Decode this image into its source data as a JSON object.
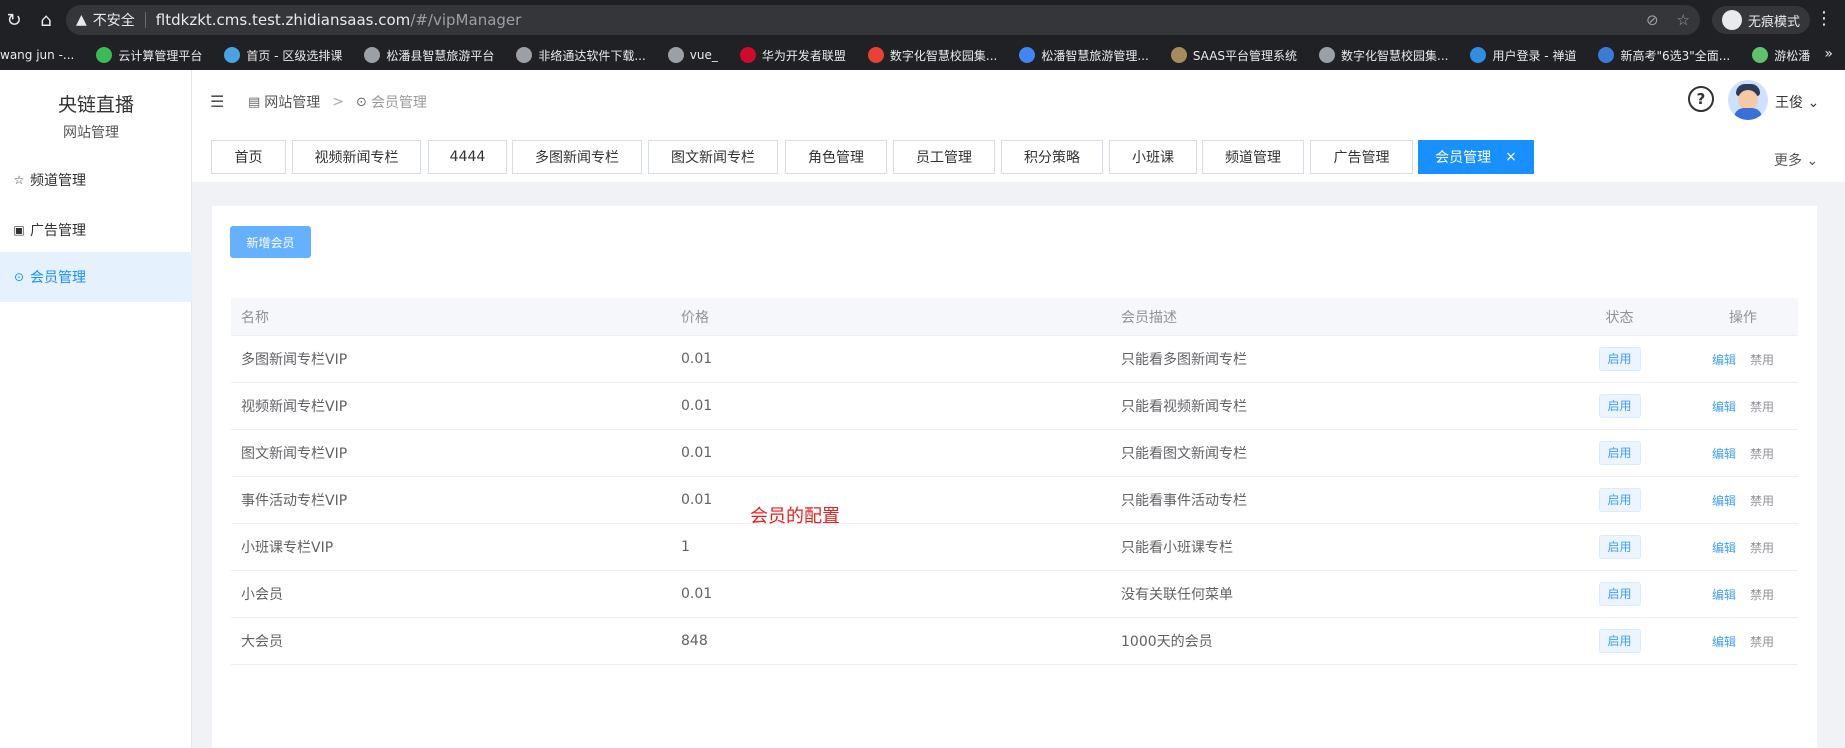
{
  "browser": {
    "insecure_label": "不安全",
    "url_host": "fltdkzkt.cms.test.zhidiansaas.com",
    "url_path": "/#/vipManager",
    "incognito_label": "无痕模式",
    "bookmarks": [
      {
        "label": "wang jun -...",
        "color": "#202124"
      },
      {
        "label": "云计算管理平台",
        "color": "#3cba54"
      },
      {
        "label": "首页 - 区级选排课",
        "color": "#4aa3df"
      },
      {
        "label": "松潘县智慧旅游平台",
        "color": "#9aa0a6"
      },
      {
        "label": "非络通达软件下载...",
        "color": "#9aa0a6"
      },
      {
        "label": "vue_",
        "color": "#9aa0a6"
      },
      {
        "label": "华为开发者联盟",
        "color": "#cf0a2c"
      },
      {
        "label": "数字化智慧校园集...",
        "color": "#e94235"
      },
      {
        "label": "松潘智慧旅游管理...",
        "color": "#4285f4"
      },
      {
        "label": "SAAS平台管理系统",
        "color": "#a68b5b"
      },
      {
        "label": "数字化智慧校园集...",
        "color": "#9aa0a6"
      },
      {
        "label": "用户登录 - 禅道",
        "color": "#2f8ee0"
      },
      {
        "label": "新高考\"6选3\"全面...",
        "color": "#3a7bd5"
      },
      {
        "label": "游松潘",
        "color": "#5ec26a"
      }
    ]
  },
  "sidebar": {
    "brand": "央链直播",
    "subtitle": "网站管理",
    "items": [
      {
        "label": "频道管理",
        "icon": "star-icon"
      },
      {
        "label": "广告管理",
        "icon": "picture-icon"
      },
      {
        "label": "会员管理",
        "icon": "play-circle-icon"
      }
    ]
  },
  "header": {
    "breadcrumb_root": "网站管理",
    "breadcrumb_current": "会员管理",
    "help_glyph": "?",
    "user_name": "王俊",
    "user_caret": "⌄"
  },
  "tabs": {
    "items": [
      "首页",
      "视频新闻专栏",
      "4444",
      "多图新闻专栏",
      "图文新闻专栏",
      "角色管理",
      "员工管理",
      "积分策略",
      "小班课",
      "频道管理",
      "广告管理",
      "会员管理"
    ],
    "close_glyph": "×",
    "more_label": "更多 ⌄"
  },
  "toolbar": {
    "add_button": "新增会员"
  },
  "table": {
    "columns": [
      "名称",
      "价格",
      "会员描述",
      "状态",
      "操作"
    ],
    "rows": [
      {
        "name": "多图新闻专栏VIP",
        "price": "0.01",
        "desc": "只能看多图新闻专栏",
        "status": "启用"
      },
      {
        "name": "视频新闻专栏VIP",
        "price": "0.01",
        "desc": "只能看视频新闻专栏",
        "status": "启用"
      },
      {
        "name": "图文新闻专栏VIP",
        "price": "0.01",
        "desc": "只能看图文新闻专栏",
        "status": "启用"
      },
      {
        "name": "事件活动专栏VIP",
        "price": "0.01",
        "desc": "只能看事件活动专栏",
        "status": "启用"
      },
      {
        "name": "小班课专栏VIP",
        "price": "1",
        "desc": "只能看小班课专栏",
        "status": "启用"
      },
      {
        "name": "小会员",
        "price": "0.01",
        "desc": "没有关联任何菜单",
        "status": "启用"
      },
      {
        "name": "大会员",
        "price": "848",
        "desc": "1000天的会员",
        "status": "启用"
      }
    ],
    "op_edit": "编辑",
    "op_disable": "禁用"
  },
  "annotation": "会员的配置",
  "colors": {
    "accent": "#1890ff",
    "annotation": "#e8211d",
    "chrome": "#202124"
  }
}
